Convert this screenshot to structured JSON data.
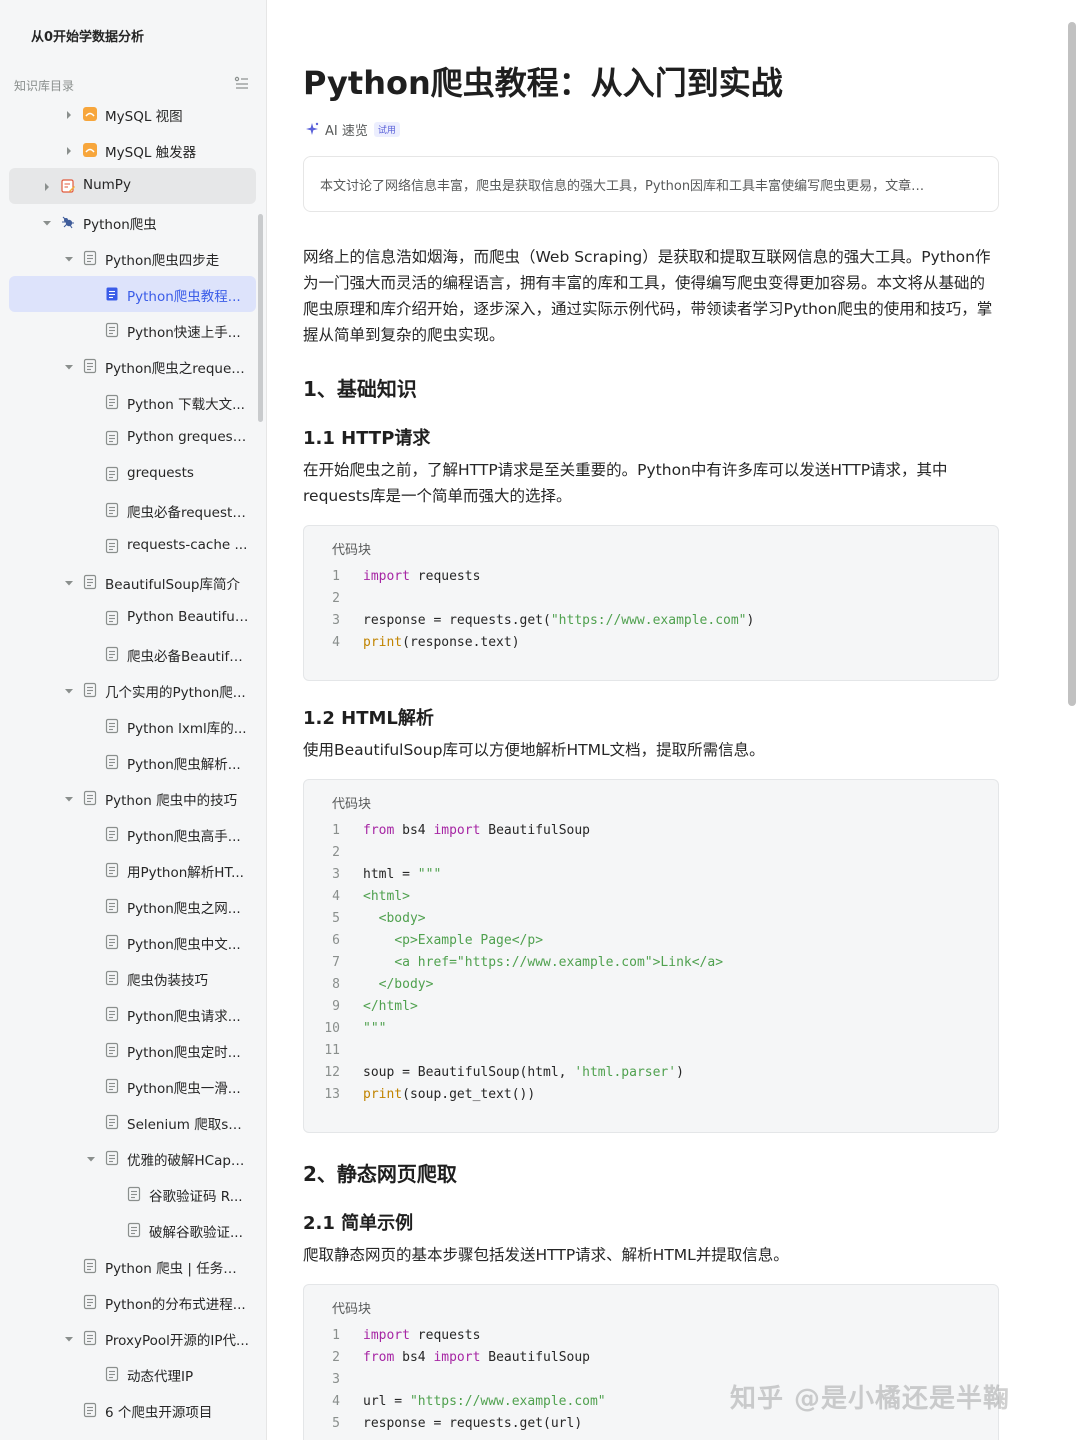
{
  "sidebar": {
    "kb_title": "从0开始学数据分析",
    "toc_label": "知识库目录",
    "items": [
      {
        "label": "MySQL 视图",
        "level": 2,
        "caret": "right",
        "icon": "orange-db-icon"
      },
      {
        "label": "MySQL 触发器",
        "level": 2,
        "caret": "right",
        "icon": "orange-db-icon"
      },
      {
        "label": "NumPy",
        "level": 1,
        "caret": "right",
        "icon": "edit-note-icon",
        "state": "hover"
      },
      {
        "label": "Python爬虫",
        "level": 1,
        "caret": "down",
        "icon": "spider-icon"
      },
      {
        "label": "Python爬虫四步走",
        "level": 2,
        "caret": "down",
        "icon": "doc-icon"
      },
      {
        "label": "Python爬虫教程...",
        "level": 3,
        "caret": "",
        "icon": "doc-icon",
        "state": "active"
      },
      {
        "label": "Python快速上手...",
        "level": 3,
        "caret": "",
        "icon": "doc-icon"
      },
      {
        "label": "Python爬虫之request...",
        "level": 2,
        "caret": "down",
        "icon": "doc-icon"
      },
      {
        "label": "Python 下载大文...",
        "level": 3,
        "caret": "",
        "icon": "doc-icon"
      },
      {
        "label": "Python grequests...",
        "level": 3,
        "caret": "",
        "icon": "doc-icon"
      },
      {
        "label": "grequests",
        "level": 3,
        "caret": "",
        "icon": "doc-icon"
      },
      {
        "label": "爬虫必备requests...",
        "level": 3,
        "caret": "",
        "icon": "doc-icon"
      },
      {
        "label": "requests-cache ...",
        "level": 3,
        "caret": "",
        "icon": "doc-icon"
      },
      {
        "label": "BeautifulSoup库简介",
        "level": 2,
        "caret": "down",
        "icon": "doc-icon"
      },
      {
        "label": "Python BeautifulS...",
        "level": 3,
        "caret": "",
        "icon": "doc-icon"
      },
      {
        "label": "爬虫必备Beautifu...",
        "level": 3,
        "caret": "",
        "icon": "doc-icon"
      },
      {
        "label": "几个实用的Python爬...",
        "level": 2,
        "caret": "down",
        "icon": "doc-icon"
      },
      {
        "label": "Python lxml库的...",
        "level": 3,
        "caret": "",
        "icon": "doc-icon"
      },
      {
        "label": "Python爬虫解析...",
        "level": 3,
        "caret": "",
        "icon": "doc-icon"
      },
      {
        "label": "Python 爬虫中的技巧",
        "level": 2,
        "caret": "down",
        "icon": "doc-icon"
      },
      {
        "label": "Python爬虫高手...",
        "level": 3,
        "caret": "",
        "icon": "doc-icon"
      },
      {
        "label": "用Python解析HT...",
        "level": 3,
        "caret": "",
        "icon": "doc-icon"
      },
      {
        "label": "Python爬虫之网...",
        "level": 3,
        "caret": "",
        "icon": "doc-icon"
      },
      {
        "label": "Python爬虫中文...",
        "level": 3,
        "caret": "",
        "icon": "doc-icon"
      },
      {
        "label": "爬虫伪装技巧",
        "level": 3,
        "caret": "",
        "icon": "doc-icon"
      },
      {
        "label": "Python爬虫请求...",
        "level": 3,
        "caret": "",
        "icon": "doc-icon"
      },
      {
        "label": "Python爬虫定时...",
        "level": 3,
        "caret": "",
        "icon": "doc-icon"
      },
      {
        "label": "Python爬虫一滑...",
        "level": 3,
        "caret": "",
        "icon": "doc-icon"
      },
      {
        "label": "Selenium 爬取sh...",
        "level": 3,
        "caret": "",
        "icon": "doc-icon"
      },
      {
        "label": "优雅的破解HCapt...",
        "level": 3,
        "caret": "down",
        "icon": "doc-icon"
      },
      {
        "label": "谷歌验证码 R...",
        "level": 4,
        "caret": "",
        "icon": "doc-icon"
      },
      {
        "label": "破解谷歌验证...",
        "level": 4,
        "caret": "",
        "icon": "doc-icon"
      },
      {
        "label": "Python 爬虫 | 任务调...",
        "level": 2,
        "caret": "",
        "icon": "doc-icon"
      },
      {
        "label": "Python的分布式进程...",
        "level": 2,
        "caret": "",
        "icon": "doc-icon"
      },
      {
        "label": "ProxyPool开源的IP代...",
        "level": 2,
        "caret": "down",
        "icon": "doc-icon"
      },
      {
        "label": "动态代理IP",
        "level": 3,
        "caret": "",
        "icon": "doc-icon"
      },
      {
        "label": "6 个爬虫开源项目",
        "level": 2,
        "caret": "",
        "icon": "doc-icon"
      }
    ]
  },
  "article": {
    "title": "Python爬虫教程：从入门到实战",
    "ai_label": "AI 速览",
    "ai_badge": "试用",
    "summary": "本文讨论了网络信息丰富，爬虫是获取信息的强大工具，Python因库和工具丰富使编写爬虫更易，文章…",
    "intro": "网络上的信息浩如烟海，而爬虫（Web Scraping）是获取和提取互联网信息的强大工具。Python作为一门强大而灵活的编程语言，拥有丰富的库和工具，使得编写爬虫变得更加容易。本文将从基础的爬虫原理和库介绍开始，逐步深入，通过实际示例代码，带领读者学习Python爬虫的使用和技巧，掌握从简单到复杂的爬虫实现。",
    "h_basic": "1、基础知识",
    "h_http": "1.1 HTTP请求",
    "p_http": "在开始爬虫之前，了解HTTP请求是至关重要的。Python中有许多库可以发送HTTP请求，其中requests库是一个简单而强大的选择。",
    "h_html": "1.2 HTML解析",
    "p_html": "使用BeautifulSoup库可以方便地解析HTML文档，提取所需信息。",
    "h_static": "2、静态网页爬取",
    "h_simple": "2.1 简单示例",
    "p_simple": "爬取静态网页的基本步骤包括发送HTTP请求、解析HTML并提取信息。",
    "code_label": "代码块",
    "watermark": "知乎 @是小橘还是半鞠"
  },
  "code_blocks": [
    {
      "lines": [
        {
          "n": "1",
          "t": "<span class=\"kw\">import</span> requests"
        },
        {
          "n": "2",
          "t": ""
        },
        {
          "n": "3",
          "t": "response = requests.get(<span class=\"st\">\"https://www.example.com\"</span>)"
        },
        {
          "n": "4",
          "t": "<span class=\"fn\">print</span>(response.text)"
        }
      ]
    },
    {
      "lines": [
        {
          "n": "1",
          "t": "<span class=\"kw\">from</span> bs4 <span class=\"kw\">import</span> BeautifulSoup"
        },
        {
          "n": "2",
          "t": ""
        },
        {
          "n": "3",
          "t": "html = <span class=\"st\">\"\"\"</span>"
        },
        {
          "n": "4",
          "t": "<span class=\"tg\">&lt;html&gt;</span>"
        },
        {
          "n": "5",
          "t": "  <span class=\"tg\">&lt;body&gt;</span>"
        },
        {
          "n": "6",
          "t": "    <span class=\"tg\">&lt;p&gt;Example Page&lt;/p&gt;</span>"
        },
        {
          "n": "7",
          "t": "    <span class=\"tg\">&lt;a href=\"https://www.example.com\"&gt;Link&lt;/a&gt;</span>"
        },
        {
          "n": "8",
          "t": "  <span class=\"tg\">&lt;/body&gt;</span>"
        },
        {
          "n": "9",
          "t": "<span class=\"tg\">&lt;/html&gt;</span>"
        },
        {
          "n": "10",
          "t": "<span class=\"st\">\"\"\"</span>"
        },
        {
          "n": "11",
          "t": ""
        },
        {
          "n": "12",
          "t": "soup = BeautifulSoup(html, <span class=\"st\">'html.parser'</span>)"
        },
        {
          "n": "13",
          "t": "<span class=\"fn\">print</span>(soup.get_text())"
        }
      ]
    },
    {
      "lines": [
        {
          "n": "1",
          "t": "<span class=\"kw\">import</span> requests"
        },
        {
          "n": "2",
          "t": "<span class=\"kw\">from</span> bs4 <span class=\"kw\">import</span> BeautifulSoup"
        },
        {
          "n": "3",
          "t": ""
        },
        {
          "n": "4",
          "t": "url = <span class=\"st\">\"https://www.example.com\"</span>"
        },
        {
          "n": "5",
          "t": "response = requests.get(url)"
        }
      ]
    }
  ],
  "colors": {
    "accent": "#3a5ce8",
    "active_bg": "#dde3fb",
    "sidebar_bg": "#f5f6f7"
  }
}
